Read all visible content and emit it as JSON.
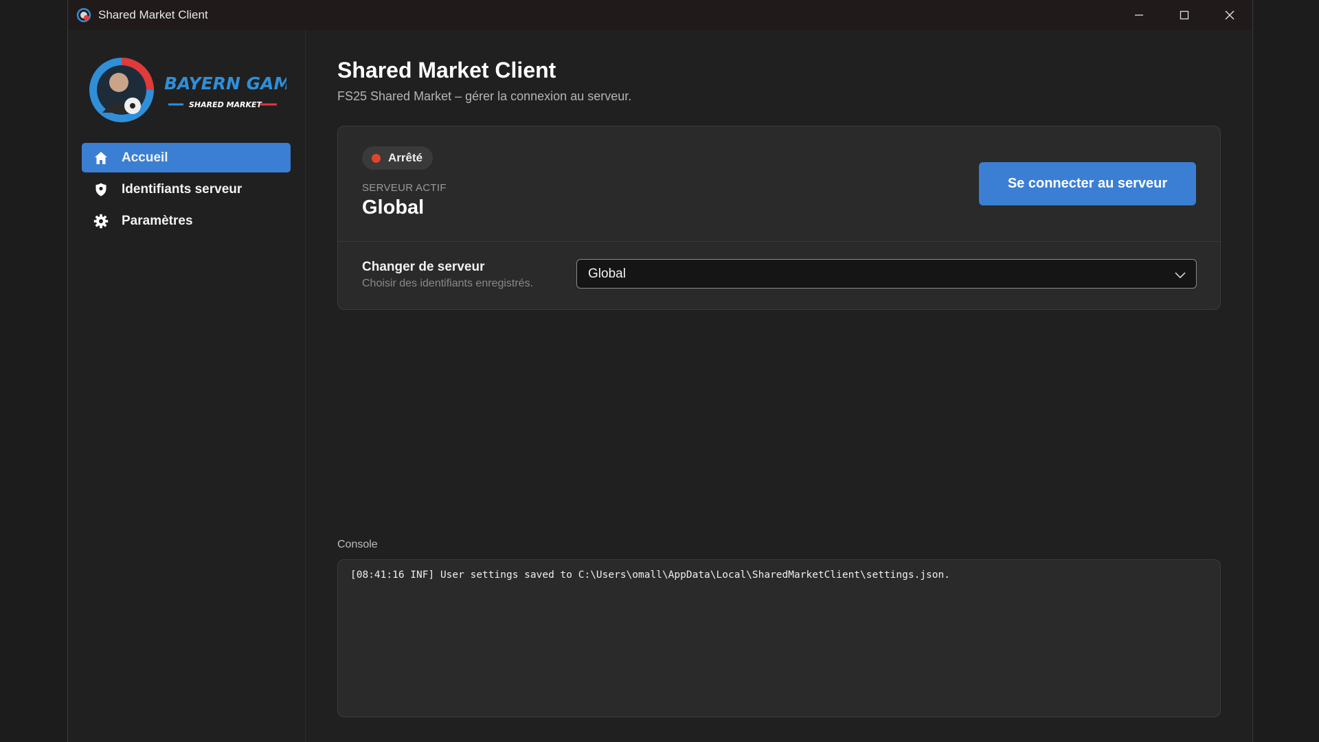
{
  "window": {
    "title": "Shared Market Client",
    "controls": [
      "minimize-icon",
      "maximize-icon",
      "close-icon"
    ]
  },
  "logo": {
    "line1": "BAYERN GAMERS",
    "line2": "SHARED MARKET"
  },
  "sidebar": {
    "items": [
      {
        "label": "Accueil",
        "icon": "home-icon",
        "active": true
      },
      {
        "label": "Identifiants serveur",
        "icon": "shield-icon",
        "active": false
      },
      {
        "label": "Paramètres",
        "icon": "gear-icon",
        "active": false
      }
    ]
  },
  "header": {
    "title": "Shared Market Client",
    "subtitle": "FS25 Shared Market – gérer la connexion au serveur."
  },
  "status": {
    "label": "Arrêté",
    "color": "#e0452b",
    "active_server_label": "SERVEUR ACTIF",
    "active_server_name": "Global",
    "connect_label": "Se connecter au serveur"
  },
  "change_server": {
    "title": "Changer de serveur",
    "subtitle": "Choisir des identifiants enregistrés.",
    "selected": "Global"
  },
  "console": {
    "label": "Console",
    "lines": [
      "[08:41:16 INF] User settings saved to C:\\Users\\omall\\AppData\\Local\\SharedMarketClient\\settings.json."
    ]
  },
  "colors": {
    "accent": "#3b7fd4",
    "background": "#202020",
    "card": "#2a2a2a"
  }
}
